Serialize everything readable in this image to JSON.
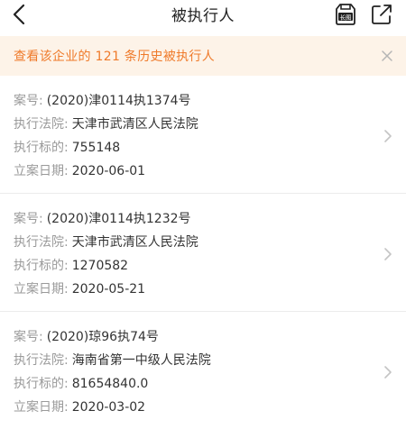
{
  "header": {
    "title": "被执行人",
    "back_icon": "chevron-left-icon",
    "long_image_icon": "long-image-icon",
    "long_image_label": "长图",
    "share_icon": "share-icon"
  },
  "banner": {
    "text": "查看该企业的 121 条历史被执行人",
    "close_icon": "close-icon"
  },
  "labels": {
    "case_no": "案号:",
    "court": "执行法院:",
    "amount": "执行标的:",
    "filing_date": "立案日期:"
  },
  "records": [
    {
      "case_no": "(2020)津0114执1374号",
      "court": "天津市武清区人民法院",
      "amount": "755148",
      "filing_date": "2020-06-01"
    },
    {
      "case_no": "(2020)津0114执1232号",
      "court": "天津市武清区人民法院",
      "amount": "1270582",
      "filing_date": "2020-05-21"
    },
    {
      "case_no": "(2020)琼96执74号",
      "court": "海南省第一中级人民法院",
      "amount": "81654840.0",
      "filing_date": "2020-03-02"
    }
  ],
  "colors": {
    "accent": "#ef7a2a",
    "banner_bg": "#fdf3e8",
    "label_gray": "#9a9a9a"
  }
}
